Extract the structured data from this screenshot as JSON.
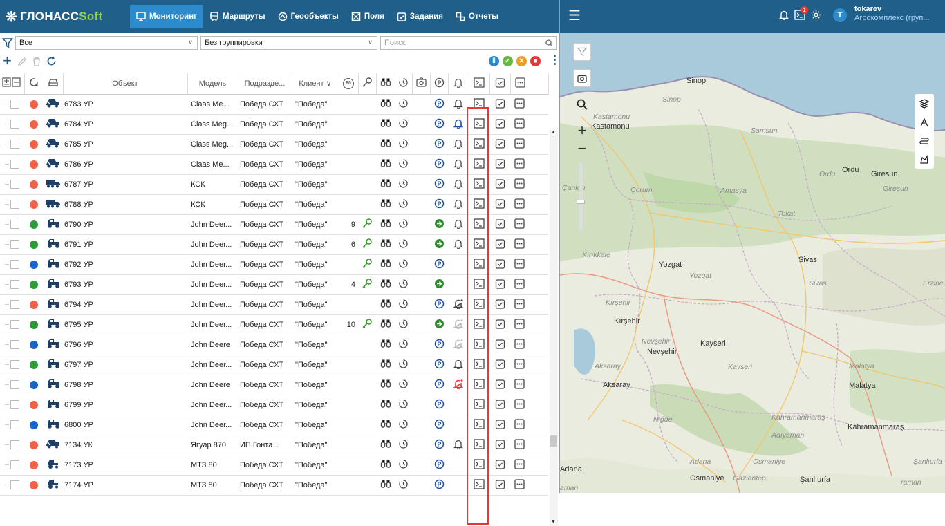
{
  "brand": {
    "logo_main": "ГЛОНАСС",
    "logo_soft": "Soft"
  },
  "nav": [
    {
      "label": "Мониторинг",
      "icon": "monitor-icon",
      "active": true
    },
    {
      "label": "Маршруты",
      "icon": "bus-icon"
    },
    {
      "label": "Геообъекты",
      "icon": "geoobject-icon"
    },
    {
      "label": "Поля",
      "icon": "field-icon"
    },
    {
      "label": "Задания",
      "icon": "task-icon"
    },
    {
      "label": "Отчеты",
      "icon": "report-icon"
    }
  ],
  "header": {
    "notification_badge": "1",
    "user_initial": "T",
    "user_name": "tokarev",
    "user_org": "Агрокомплекс (груп..."
  },
  "filters": {
    "object_filter": "Все",
    "grouping": "Без группировки",
    "search_placeholder": "Поиск"
  },
  "columns": {
    "object": "Объект",
    "model": "Модель",
    "dept": "Подразде...",
    "client": "Клиент ∨",
    "speed": "90"
  },
  "status_colors": {
    "red": "#f0614a",
    "green": "#2e9a3a",
    "blue": "#1a63c9",
    "accent": "#1f5f8a"
  },
  "rows": [
    {
      "status": "red",
      "vehicle": "harvester",
      "name": "6783 УР",
      "model": "Claas Me...",
      "dept": "Победа СХТ",
      "client": "\"Победа\"",
      "speed": "",
      "key": false,
      "parking": "p",
      "bell": "normal"
    },
    {
      "status": "red",
      "vehicle": "harvester",
      "name": "6784 УР",
      "model": "Class Meg...",
      "dept": "Победа СХТ",
      "client": "\"Победа\"",
      "speed": "",
      "key": false,
      "parking": "p",
      "bell": "blue"
    },
    {
      "status": "red",
      "vehicle": "harvester",
      "name": "6785 УР",
      "model": "Class Meg...",
      "dept": "Победа СХТ",
      "client": "\"Победа\"",
      "speed": "",
      "key": false,
      "parking": "p",
      "bell": "normal"
    },
    {
      "status": "red",
      "vehicle": "harvester",
      "name": "6786 УР",
      "model": "Claas Me...",
      "dept": "Победа СХТ",
      "client": "\"Победа\"",
      "speed": "",
      "key": false,
      "parking": "p",
      "bell": "normal"
    },
    {
      "status": "red",
      "vehicle": "truck",
      "name": "6787 УР",
      "model": "КСК",
      "dept": "Победа СХТ",
      "client": "\"Победа\"",
      "speed": "",
      "key": false,
      "parking": "p",
      "bell": "normal"
    },
    {
      "status": "red",
      "vehicle": "truck",
      "name": "6788 УР",
      "model": "КСК",
      "dept": "Победа СХТ",
      "client": "\"Победа\"",
      "speed": "",
      "key": false,
      "parking": "p",
      "bell": "normal"
    },
    {
      "status": "green",
      "vehicle": "tractor",
      "name": "6790 УР",
      "model": "John Deer...",
      "dept": "Победа СХТ",
      "client": "\"Победа\"",
      "speed": "9",
      "key": true,
      "parking": "move",
      "bell": "normal"
    },
    {
      "status": "green",
      "vehicle": "tractor",
      "name": "6791 УР",
      "model": "John Deer...",
      "dept": "Победа СХТ",
      "client": "\"Победа\"",
      "speed": "6",
      "key": true,
      "parking": "move",
      "bell": "normal"
    },
    {
      "status": "blue",
      "vehicle": "tractor",
      "name": "6792 УР",
      "model": "John Deer...",
      "dept": "Победа СХТ",
      "client": "\"Победа\"",
      "speed": "",
      "key": true,
      "parking": "p",
      "bell": "none"
    },
    {
      "status": "green",
      "vehicle": "tractor",
      "name": "6793 УР",
      "model": "John Deer...",
      "dept": "Победа СХТ",
      "client": "\"Победа\"",
      "speed": "4",
      "key": true,
      "parking": "move",
      "bell": "none"
    },
    {
      "status": "red",
      "vehicle": "tractor",
      "name": "6794 УР",
      "model": "John Deer...",
      "dept": "Победа СХТ",
      "client": "\"Победа\"",
      "speed": "",
      "key": false,
      "parking": "p",
      "bell": "alert"
    },
    {
      "status": "green",
      "vehicle": "tractor",
      "name": "6795 УР",
      "model": "John Deer...",
      "dept": "Победа СХТ",
      "client": "\"Победа\"",
      "speed": "10",
      "key": true,
      "parking": "move",
      "bell": "alert-grey"
    },
    {
      "status": "blue",
      "vehicle": "tractor",
      "name": "6796 УР",
      "model": "John Deere",
      "dept": "Победа СХТ",
      "client": "\"Победа\"",
      "speed": "",
      "key": false,
      "parking": "p",
      "bell": "alert-grey"
    },
    {
      "status": "green",
      "vehicle": "tractor",
      "name": "6797 УР",
      "model": "John Deer...",
      "dept": "Победа СХТ",
      "client": "\"Победа\"",
      "speed": "",
      "key": false,
      "parking": "p",
      "bell": "normal"
    },
    {
      "status": "blue",
      "vehicle": "tractor",
      "name": "6798 УР",
      "model": "John Deere",
      "dept": "Победа СХТ",
      "client": "\"Победа\"",
      "speed": "",
      "key": false,
      "parking": "p",
      "bell": "alert-red"
    },
    {
      "status": "red",
      "vehicle": "tractor",
      "name": "6799 УР",
      "model": "John Deer...",
      "dept": "Победа СХТ",
      "client": "\"Победа\"",
      "speed": "",
      "key": false,
      "parking": "p",
      "bell": "none"
    },
    {
      "status": "blue",
      "vehicle": "tractor",
      "name": "6800 УР",
      "model": "John Deer...",
      "dept": "Победа СХТ",
      "client": "\"Победа\"",
      "speed": "",
      "key": false,
      "parking": "p",
      "bell": "none"
    },
    {
      "status": "red",
      "vehicle": "harvester",
      "name": "7134 УК",
      "model": "Ягуар 870",
      "dept": "ИП Гонта...",
      "client": "\"Победа\"",
      "speed": "",
      "key": false,
      "parking": "p",
      "bell": "normal"
    },
    {
      "status": "red",
      "vehicle": "small-tractor",
      "name": "7173 УР",
      "model": "МТЗ 80",
      "dept": "Победа СХТ",
      "client": "\"Победа\"",
      "speed": "",
      "key": false,
      "parking": "p",
      "bell": "none"
    },
    {
      "status": "red",
      "vehicle": "small-tractor",
      "name": "7174 УР",
      "model": "МТЗ 80",
      "dept": "Победа СХТ",
      "client": "\"Победа\"",
      "speed": "",
      "key": false,
      "parking": "p",
      "bell": "none"
    }
  ],
  "map": {
    "labels": [
      {
        "text": "Sinop",
        "style": "city"
      },
      {
        "text": "Sinop",
        "style": "region"
      },
      {
        "text": "Kastamonu",
        "style": "region"
      },
      {
        "text": "Kastamonu",
        "style": "city"
      },
      {
        "text": "Samsun",
        "style": "region"
      },
      {
        "text": "Ordu",
        "style": "region"
      },
      {
        "text": "Ordu",
        "style": "city"
      },
      {
        "text": "Giresun",
        "style": "city"
      },
      {
        "text": "Giresun",
        "style": "region"
      },
      {
        "text": "Çankırı",
        "style": "region"
      },
      {
        "text": "Çorum",
        "style": "region"
      },
      {
        "text": "Amasya",
        "style": "region"
      },
      {
        "text": "Tokat",
        "style": "region"
      },
      {
        "text": "Kırıkkale",
        "style": "region"
      },
      {
        "text": "Yozgat",
        "style": "city"
      },
      {
        "text": "Yozgat",
        "style": "region"
      },
      {
        "text": "Sivas",
        "style": "city"
      },
      {
        "text": "Sivas",
        "style": "region"
      },
      {
        "text": "Erzinc",
        "style": "region"
      },
      {
        "text": "Kırşehir",
        "style": "region"
      },
      {
        "text": "Kırşehir",
        "style": "city"
      },
      {
        "text": "Nevşehir",
        "style": "region"
      },
      {
        "text": "Nevşehir",
        "style": "city"
      },
      {
        "text": "Kayseri",
        "style": "city"
      },
      {
        "text": "Kayseri",
        "style": "region"
      },
      {
        "text": "Malatya",
        "style": "region"
      },
      {
        "text": "Malatya",
        "style": "city"
      },
      {
        "text": "Aksaray",
        "style": "region"
      },
      {
        "text": "Aksaray",
        "style": "city"
      },
      {
        "text": "Niğde",
        "style": "region"
      },
      {
        "text": "Kahramanmaraş",
        "style": "region"
      },
      {
        "text": "Kahramanmaraş",
        "style": "city"
      },
      {
        "text": "Adıyaman",
        "style": "region"
      },
      {
        "text": "Adana",
        "style": "region"
      },
      {
        "text": "Osmaniye",
        "style": "region"
      },
      {
        "text": "Şanlıurfa",
        "style": "region"
      },
      {
        "text": "Adana",
        "style": "city"
      },
      {
        "text": "Osmaniye",
        "style": "city"
      },
      {
        "text": "Gaziantep",
        "style": "region"
      },
      {
        "text": "Şanlıurfa",
        "style": "city"
      },
      {
        "text": "raman",
        "style": "region"
      },
      {
        "text": "aman",
        "style": "region"
      }
    ]
  }
}
